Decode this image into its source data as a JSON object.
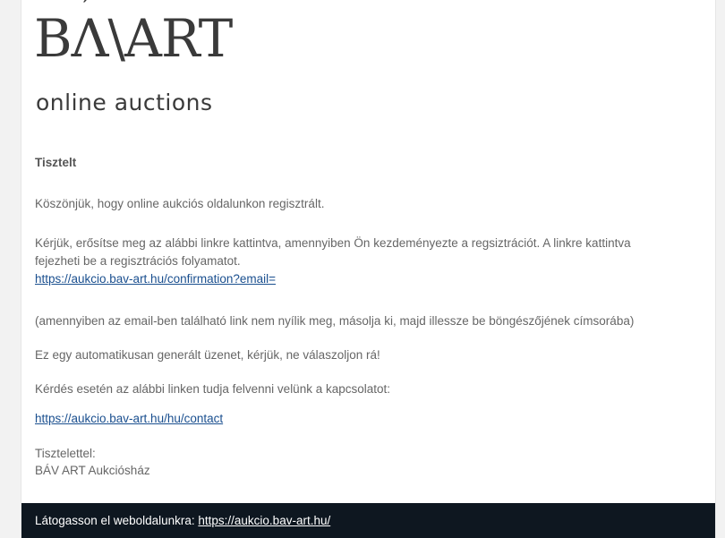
{
  "logo": {
    "mark_b": "B",
    "mark_a": "Λ",
    "mark_accent": "´",
    "mark_rest": "\\ART",
    "tagline": "online auctions"
  },
  "email": {
    "greeting": "Tisztelt",
    "p1": "Köszönjük, hogy online aukciós oldalunkon regisztrált.",
    "p2_line1": "Kérjük, erősítse meg az alábbi linkre kattintva, amennyiben Ön kezdeményezte a regsiztrációt. A linkre kattintva",
    "p2_line2": "fejezheti be a regisztrációs folyamatot.",
    "confirm_link": "https://aukcio.bav-art.hu/confirmation?email=",
    "p3": "(amennyiben az email-ben található link nem nyílik meg, másolja ki, majd illessze be böngészőjének címsorába)",
    "p4": "Ez egy automatikusan generált üzenet, kérjük, ne válaszoljon rá!",
    "p5": "Kérdés esetén az alábbi linken tudja felvenni velünk a kapcsolatot:",
    "contact_link": "https://aukcio.bav-art.hu/hu/contact",
    "closing": "Tisztelettel:",
    "signature": "BÁV ART Aukciósház"
  },
  "footer": {
    "text": "Látogasson el weboldalunkra: ",
    "link": "https://aukcio.bav-art.hu/"
  }
}
